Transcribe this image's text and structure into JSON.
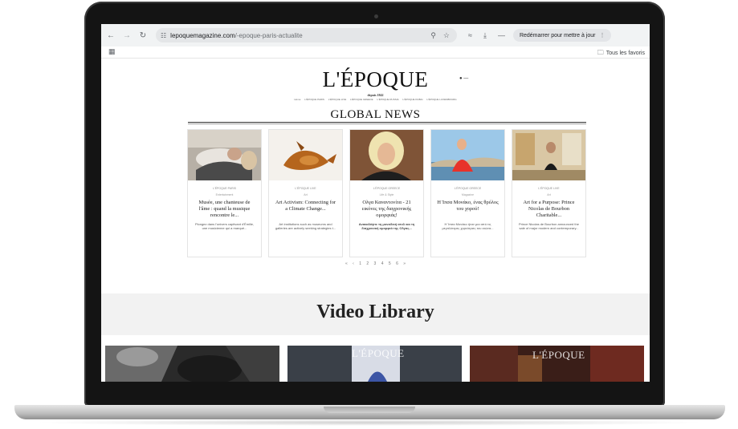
{
  "browser": {
    "url_host": "lepoquemagazine.com",
    "url_path": "/-epoque-paris-actualite",
    "relaunch_label": "Redémarrer pour mettre à jour",
    "all_bookmarks_label": "Tous les favoris",
    "icons": {
      "back": "arrow-left-icon",
      "forward": "arrow-right-icon",
      "reload": "reload-icon",
      "site_info": "tune-icon",
      "zoom": "zoom-icon",
      "bookmark": "star-icon",
      "extension": "extension-icon",
      "download": "download-icon",
      "more": "more-icon",
      "apps": "apps-grid-icon",
      "folder": "folder-icon"
    }
  },
  "site": {
    "logo": "L'ÉPOQUE",
    "tagline": "depuis 1842",
    "nav_items": [
      "Home",
      "L'ÉPOQUE PARIS",
      "L'ÉPOQUE LIVE",
      "L'ÉPOQUE GREECE",
      "L'ÉPOQUE RUSSIA",
      "L'ÉPOQUE DUBAI",
      "L'ÉPOQUE LUXEMBOURG"
    ]
  },
  "global_news": {
    "title": "GLOBAL NEWS",
    "cards": [
      {
        "category": "L'ÉPOQUE PARIS",
        "subcategory": "Entertainment",
        "title": "Musée, une chanteuse de l'âme : quand la musique rencontre le...",
        "excerpt": "Plongez dans l'univers captivant d'Émilie, une musicienne qui a marqué..."
      },
      {
        "category": "L'ÉPOQUE LIVE",
        "subcategory": "Art",
        "title": "Art Activism: Connecting for a Climate Change...",
        "excerpt": "Art institutions such as museums and galleries are actively seeking strategies t..."
      },
      {
        "category": "L'ÉPOQUE GREECE",
        "subcategory": "Life & Style",
        "title": "Ολγα Καναντονίτα - 21 εικόνες της διαχρονικής ομορφιάς!",
        "excerpt": "Ανακαλύψτε τη μοναδική ατυλ και τη διαχρονική ομορφιά της Ολγας..."
      },
      {
        "category": "L'ÉPOQUE GREECE",
        "subcategory": "Magazine",
        "title": "Η Ίπσα Μονάκο, ένας θρύλος του χορού!",
        "excerpt": "Η Ίπσα Μονάκο ήταν μια από τις μεγαλύτερες χορεύτριες του αιώνα..."
      },
      {
        "category": "L'ÉPOQUE LIVE",
        "subcategory": "Art",
        "title": "Art for a Purpose: Prince Nicolas de Bourbon Charitable...",
        "excerpt": "Prince Nicolas de Bourbon announced the sale of major modern and contemporary..."
      }
    ],
    "pagination": [
      "«",
      "‹",
      "1",
      "2",
      "3",
      "4",
      "5",
      "6",
      "»"
    ]
  },
  "video_library": {
    "title": "Video Library",
    "videos": [
      {
        "watermark": ""
      },
      {
        "watermark": "L'ÉPOQUE"
      },
      {
        "watermark": "L'ÉPOQUE"
      }
    ]
  }
}
